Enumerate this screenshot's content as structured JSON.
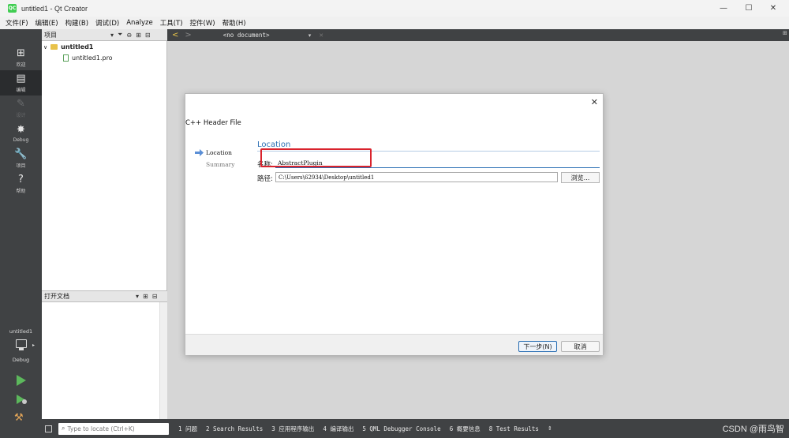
{
  "window": {
    "title": "untitled1 - Qt Creator",
    "app_icon_text": "QC",
    "minimize": "—",
    "maximize": "☐",
    "close": "✕"
  },
  "menu": [
    "文件(F)",
    "编辑(E)",
    "构建(B)",
    "调试(D)",
    "Analyze",
    "工具(T)",
    "控件(W)",
    "帮助(H)"
  ],
  "modes": [
    {
      "label": "欢迎",
      "icon": "⊞"
    },
    {
      "label": "编辑",
      "icon": "▤"
    },
    {
      "label": "设计",
      "icon": "✎"
    },
    {
      "label": "Debug",
      "icon": "✸"
    },
    {
      "label": "项目",
      "icon": "🔧"
    },
    {
      "label": "帮助",
      "icon": "?"
    }
  ],
  "project_panel": {
    "header": "项目",
    "tree": [
      {
        "label": "untitled1",
        "expander": "∨"
      },
      {
        "label": "untitled1.pro"
      }
    ]
  },
  "open_docs_panel": {
    "header": "打开文档"
  },
  "editor_toolbar": {
    "back": "<",
    "forward": ">",
    "document": "<no document>",
    "close": "✕"
  },
  "dialog": {
    "close": "✕",
    "title": "C++ Header File",
    "steps": [
      "Location",
      "Summary"
    ],
    "heading": "Location",
    "name_label": "名称:",
    "name_value": "AbstractPlugin",
    "path_label": "路径:",
    "path_value": "C:\\Users\\62934\\Desktop\\untitled1",
    "browse": "浏览...",
    "next": "下一步(N)",
    "cancel": "取消"
  },
  "kit": {
    "name": "untitled1",
    "mode": "Debug"
  },
  "statusbar": {
    "locator_placeholder": "Type to locate (Ctrl+K)",
    "tabs": [
      "1 问题",
      "2 Search Results",
      "3 应用程序输出",
      "4 编译输出",
      "5 QML Debugger Console",
      "6 概要信息",
      "8 Test Results"
    ],
    "updown": "⇕"
  },
  "watermark": "CSDN @雨鸟智",
  "colors": {
    "accent": "#2b6fb3",
    "highlight": "#d9232d",
    "run": "#5cb85c",
    "sidebar": "#404244"
  }
}
